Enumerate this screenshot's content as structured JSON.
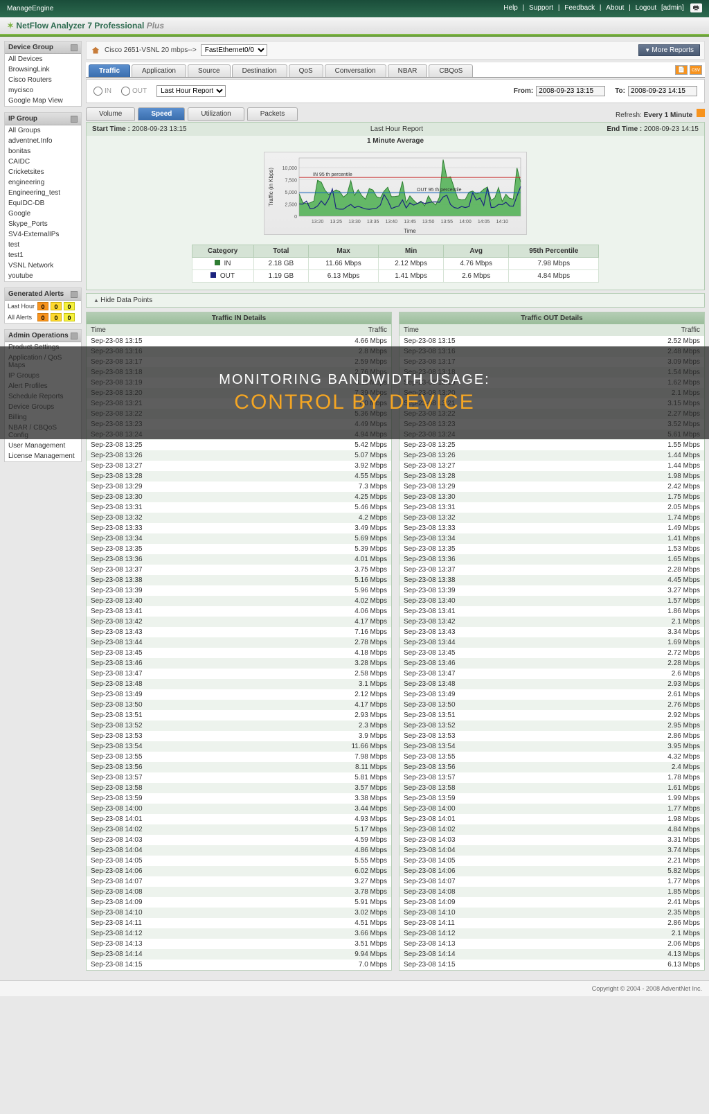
{
  "header": {
    "product": "ManageEngine",
    "title": "NetFlow Analyzer 7 Professional",
    "suffix": "Plus",
    "links": [
      "Help",
      "Support",
      "Feedback",
      "About",
      "Logout"
    ],
    "user": "[admin]"
  },
  "sidebar": {
    "device_group": {
      "title": "Device Group",
      "items": [
        "All Devices",
        "BrowsingLink",
        "Cisco Routers",
        "mycisco",
        "Google Map View"
      ]
    },
    "ip_group": {
      "title": "IP Group",
      "items": [
        "All Groups",
        "adventnet.Info",
        "bonitas",
        "CAIDC",
        "Cricketsites",
        "engineering",
        "Engineering_test",
        "EquIDC-DB",
        "Google",
        "Skype_Ports",
        "SV4-ExternalIPs",
        "test",
        "test1",
        "VSNL Network",
        "youtube"
      ]
    },
    "alerts": {
      "title": "Generated Alerts",
      "rows": [
        {
          "label": "Last Hour",
          "r": "0",
          "o": "0",
          "y": "0"
        },
        {
          "label": "All Alerts",
          "r": "0",
          "o": "0",
          "y": "0"
        }
      ]
    },
    "admin": {
      "title": "Admin Operations",
      "items": [
        "Product Settings",
        "Application / QoS Maps",
        "IP Groups",
        "Alert Profiles",
        "Schedule Reports",
        "Device Groups",
        "Billing",
        "NBAR / CBQoS Config",
        "User Management",
        "License Management"
      ]
    }
  },
  "breadcrumb": {
    "device": "Cisco 2651-VSNL 20 mbps-->",
    "iface": "FastEthernet0/0",
    "more": "More Reports"
  },
  "tabs": [
    "Traffic",
    "Application",
    "Source",
    "Destination",
    "QoS",
    "Conversation",
    "NBAR",
    "CBQoS"
  ],
  "filter": {
    "in": "IN",
    "out": "OUT",
    "report": "Last Hour Report",
    "from_l": "From:",
    "from": "2008-09-23 13:15",
    "to_l": "To:",
    "to": "2008-09-23 14:15"
  },
  "subtabs": [
    "Volume",
    "Speed",
    "Utilization",
    "Packets"
  ],
  "refresh": {
    "label": "Refresh:",
    "value": "Every 1 Minute"
  },
  "chart": {
    "start_l": "Start Time :",
    "start": "2008-09-23 13:15",
    "mid": "Last Hour Report",
    "end_l": "End Time :",
    "end": "2008-09-23 14:15",
    "title": "1 Minute Average",
    "ylabel": "Traffic (in Kbps)",
    "xlabel": "Time",
    "ann_in": "IN 95 th percentile",
    "ann_out": "OUT 95 th percentile"
  },
  "summary": {
    "headers": [
      "Category",
      "Total",
      "Max",
      "Min",
      "Avg",
      "95th Percentile"
    ],
    "rows": [
      {
        "cat": "IN",
        "total": "2.18 GB",
        "max": "11.66 Mbps",
        "min": "2.12 Mbps",
        "avg": "4.76 Mbps",
        "p95": "7.98 Mbps"
      },
      {
        "cat": "OUT",
        "total": "1.19 GB",
        "max": "6.13 Mbps",
        "min": "1.41 Mbps",
        "avg": "2.6 Mbps",
        "p95": "4.84 Mbps"
      }
    ]
  },
  "hide_dp": "Hide Data Points",
  "details": {
    "in_title": "Traffic IN Details",
    "out_title": "Traffic OUT Details",
    "col_time": "Time",
    "col_traffic": "Traffic",
    "in": [
      [
        "Sep-23-08 13:15",
        "4.66 Mbps"
      ],
      [
        "Sep-23-08 13:16",
        "2.8 Mbps"
      ],
      [
        "Sep-23-08 13:17",
        "2.59 Mbps"
      ],
      [
        "Sep-23-08 13:18",
        "2.76 Mbps"
      ],
      [
        "Sep-23-08 13:19",
        "3.11 Mbps"
      ],
      [
        "Sep-23-08 13:20",
        "7.39 Mbps"
      ],
      [
        "Sep-23-08 13:21",
        "7.0 Mbps"
      ],
      [
        "Sep-23-08 13:22",
        "5.36 Mbps"
      ],
      [
        "Sep-23-08 13:23",
        "4.49 Mbps"
      ],
      [
        "Sep-23-08 13:24",
        "4.94 Mbps"
      ],
      [
        "Sep-23-08 13:25",
        "5.42 Mbps"
      ],
      [
        "Sep-23-08 13:26",
        "5.07 Mbps"
      ],
      [
        "Sep-23-08 13:27",
        "3.92 Mbps"
      ],
      [
        "Sep-23-08 13:28",
        "4.55 Mbps"
      ],
      [
        "Sep-23-08 13:29",
        "7.3 Mbps"
      ],
      [
        "Sep-23-08 13:30",
        "4.25 Mbps"
      ],
      [
        "Sep-23-08 13:31",
        "5.46 Mbps"
      ],
      [
        "Sep-23-08 13:32",
        "4.2 Mbps"
      ],
      [
        "Sep-23-08 13:33",
        "3.49 Mbps"
      ],
      [
        "Sep-23-08 13:34",
        "5.69 Mbps"
      ],
      [
        "Sep-23-08 13:35",
        "5.39 Mbps"
      ],
      [
        "Sep-23-08 13:36",
        "4.01 Mbps"
      ],
      [
        "Sep-23-08 13:37",
        "3.75 Mbps"
      ],
      [
        "Sep-23-08 13:38",
        "5.16 Mbps"
      ],
      [
        "Sep-23-08 13:39",
        "5.96 Mbps"
      ],
      [
        "Sep-23-08 13:40",
        "4.02 Mbps"
      ],
      [
        "Sep-23-08 13:41",
        "4.06 Mbps"
      ],
      [
        "Sep-23-08 13:42",
        "4.17 Mbps"
      ],
      [
        "Sep-23-08 13:43",
        "7.16 Mbps"
      ],
      [
        "Sep-23-08 13:44",
        "2.78 Mbps"
      ],
      [
        "Sep-23-08 13:45",
        "4.18 Mbps"
      ],
      [
        "Sep-23-08 13:46",
        "3.28 Mbps"
      ],
      [
        "Sep-23-08 13:47",
        "2.58 Mbps"
      ],
      [
        "Sep-23-08 13:48",
        "3.1 Mbps"
      ],
      [
        "Sep-23-08 13:49",
        "2.12 Mbps"
      ],
      [
        "Sep-23-08 13:50",
        "4.17 Mbps"
      ],
      [
        "Sep-23-08 13:51",
        "2.93 Mbps"
      ],
      [
        "Sep-23-08 13:52",
        "2.3 Mbps"
      ],
      [
        "Sep-23-08 13:53",
        "3.9 Mbps"
      ],
      [
        "Sep-23-08 13:54",
        "11.66 Mbps"
      ],
      [
        "Sep-23-08 13:55",
        "7.98 Mbps"
      ],
      [
        "Sep-23-08 13:56",
        "8.11 Mbps"
      ],
      [
        "Sep-23-08 13:57",
        "5.81 Mbps"
      ],
      [
        "Sep-23-08 13:58",
        "3.57 Mbps"
      ],
      [
        "Sep-23-08 13:59",
        "3.38 Mbps"
      ],
      [
        "Sep-23-08 14:00",
        "3.44 Mbps"
      ],
      [
        "Sep-23-08 14:01",
        "4.93 Mbps"
      ],
      [
        "Sep-23-08 14:02",
        "5.17 Mbps"
      ],
      [
        "Sep-23-08 14:03",
        "4.59 Mbps"
      ],
      [
        "Sep-23-08 14:04",
        "4.86 Mbps"
      ],
      [
        "Sep-23-08 14:05",
        "5.55 Mbps"
      ],
      [
        "Sep-23-08 14:06",
        "6.02 Mbps"
      ],
      [
        "Sep-23-08 14:07",
        "3.27 Mbps"
      ],
      [
        "Sep-23-08 14:08",
        "3.78 Mbps"
      ],
      [
        "Sep-23-08 14:09",
        "5.91 Mbps"
      ],
      [
        "Sep-23-08 14:10",
        "3.02 Mbps"
      ],
      [
        "Sep-23-08 14:11",
        "4.51 Mbps"
      ],
      [
        "Sep-23-08 14:12",
        "3.66 Mbps"
      ],
      [
        "Sep-23-08 14:13",
        "3.51 Mbps"
      ],
      [
        "Sep-23-08 14:14",
        "9.94 Mbps"
      ],
      [
        "Sep-23-08 14:15",
        "7.0 Mbps"
      ]
    ],
    "out": [
      [
        "Sep-23-08 13:15",
        "2.52 Mbps"
      ],
      [
        "Sep-23-08 13:16",
        "2.48 Mbps"
      ],
      [
        "Sep-23-08 13:17",
        "3.09 Mbps"
      ],
      [
        "Sep-23-08 13:18",
        "1.54 Mbps"
      ],
      [
        "Sep-23-08 13:19",
        "1.62 Mbps"
      ],
      [
        "Sep-23-08 13:20",
        "2.1 Mbps"
      ],
      [
        "Sep-23-08 13:21",
        "3.15 Mbps"
      ],
      [
        "Sep-23-08 13:22",
        "2.27 Mbps"
      ],
      [
        "Sep-23-08 13:23",
        "3.52 Mbps"
      ],
      [
        "Sep-23-08 13:24",
        "5.61 Mbps"
      ],
      [
        "Sep-23-08 13:25",
        "1.55 Mbps"
      ],
      [
        "Sep-23-08 13:26",
        "1.44 Mbps"
      ],
      [
        "Sep-23-08 13:27",
        "1.44 Mbps"
      ],
      [
        "Sep-23-08 13:28",
        "1.98 Mbps"
      ],
      [
        "Sep-23-08 13:29",
        "2.42 Mbps"
      ],
      [
        "Sep-23-08 13:30",
        "1.75 Mbps"
      ],
      [
        "Sep-23-08 13:31",
        "2.05 Mbps"
      ],
      [
        "Sep-23-08 13:32",
        "1.74 Mbps"
      ],
      [
        "Sep-23-08 13:33",
        "1.49 Mbps"
      ],
      [
        "Sep-23-08 13:34",
        "1.41 Mbps"
      ],
      [
        "Sep-23-08 13:35",
        "1.53 Mbps"
      ],
      [
        "Sep-23-08 13:36",
        "1.65 Mbps"
      ],
      [
        "Sep-23-08 13:37",
        "2.28 Mbps"
      ],
      [
        "Sep-23-08 13:38",
        "4.45 Mbps"
      ],
      [
        "Sep-23-08 13:39",
        "3.27 Mbps"
      ],
      [
        "Sep-23-08 13:40",
        "1.57 Mbps"
      ],
      [
        "Sep-23-08 13:41",
        "1.86 Mbps"
      ],
      [
        "Sep-23-08 13:42",
        "2.1 Mbps"
      ],
      [
        "Sep-23-08 13:43",
        "3.34 Mbps"
      ],
      [
        "Sep-23-08 13:44",
        "1.69 Mbps"
      ],
      [
        "Sep-23-08 13:45",
        "2.72 Mbps"
      ],
      [
        "Sep-23-08 13:46",
        "2.28 Mbps"
      ],
      [
        "Sep-23-08 13:47",
        "2.6 Mbps"
      ],
      [
        "Sep-23-08 13:48",
        "2.93 Mbps"
      ],
      [
        "Sep-23-08 13:49",
        "2.61 Mbps"
      ],
      [
        "Sep-23-08 13:50",
        "2.76 Mbps"
      ],
      [
        "Sep-23-08 13:51",
        "2.92 Mbps"
      ],
      [
        "Sep-23-08 13:52",
        "2.95 Mbps"
      ],
      [
        "Sep-23-08 13:53",
        "2.86 Mbps"
      ],
      [
        "Sep-23-08 13:54",
        "3.95 Mbps"
      ],
      [
        "Sep-23-08 13:55",
        "4.32 Mbps"
      ],
      [
        "Sep-23-08 13:56",
        "2.4 Mbps"
      ],
      [
        "Sep-23-08 13:57",
        "1.78 Mbps"
      ],
      [
        "Sep-23-08 13:58",
        "1.61 Mbps"
      ],
      [
        "Sep-23-08 13:59",
        "1.99 Mbps"
      ],
      [
        "Sep-23-08 14:00",
        "1.77 Mbps"
      ],
      [
        "Sep-23-08 14:01",
        "1.98 Mbps"
      ],
      [
        "Sep-23-08 14:02",
        "4.84 Mbps"
      ],
      [
        "Sep-23-08 14:03",
        "3.31 Mbps"
      ],
      [
        "Sep-23-08 14:04",
        "3.74 Mbps"
      ],
      [
        "Sep-23-08 14:05",
        "2.21 Mbps"
      ],
      [
        "Sep-23-08 14:06",
        "5.82 Mbps"
      ],
      [
        "Sep-23-08 14:07",
        "1.77 Mbps"
      ],
      [
        "Sep-23-08 14:08",
        "1.85 Mbps"
      ],
      [
        "Sep-23-08 14:09",
        "2.41 Mbps"
      ],
      [
        "Sep-23-08 14:10",
        "2.35 Mbps"
      ],
      [
        "Sep-23-08 14:11",
        "2.86 Mbps"
      ],
      [
        "Sep-23-08 14:12",
        "2.1 Mbps"
      ],
      [
        "Sep-23-08 14:13",
        "2.06 Mbps"
      ],
      [
        "Sep-23-08 14:14",
        "4.13 Mbps"
      ],
      [
        "Sep-23-08 14:15",
        "6.13 Mbps"
      ]
    ]
  },
  "footer": "Copyright © 2004 - 2008 AdventNet Inc.",
  "overlay": {
    "l1": "MONITORING BANDWIDTH USAGE:",
    "l2": "CONTROL BY DEVICE"
  },
  "chart_data": {
    "type": "line",
    "title": "1 Minute Average",
    "xlabel": "Time",
    "ylabel": "Traffic (in Kbps)",
    "ylim": [
      0,
      12000
    ],
    "yticks": [
      0,
      2500,
      5000,
      7500,
      10000
    ],
    "xticks": [
      "13:20",
      "13:25",
      "13:30",
      "13:35",
      "13:40",
      "13:45",
      "13:50",
      "13:55",
      "14:00",
      "14:05",
      "14:10"
    ],
    "series": [
      {
        "name": "IN",
        "color": "#2e7d32",
        "fill": "#4caf50",
        "values": [
          4660,
          2800,
          2590,
          2760,
          3110,
          7390,
          7000,
          5360,
          4490,
          4940,
          5420,
          5070,
          3920,
          4550,
          7300,
          4250,
          5460,
          4200,
          3490,
          5690,
          5390,
          4010,
          3750,
          5160,
          5960,
          4020,
          4060,
          4170,
          7160,
          2780,
          4180,
          3280,
          2580,
          3100,
          2120,
          4170,
          2930,
          2300,
          3900,
          11660,
          7980,
          8110,
          5810,
          3570,
          3380,
          3440,
          4930,
          5170,
          4590,
          4860,
          5550,
          6020,
          3270,
          3780,
          5910,
          3020,
          4510,
          3660,
          3510,
          9940,
          7000
        ]
      },
      {
        "name": "OUT",
        "color": "#1a237e",
        "values": [
          2520,
          2480,
          3090,
          1540,
          1620,
          2100,
          3150,
          2270,
          3520,
          5610,
          1550,
          1440,
          1440,
          1980,
          2420,
          1750,
          2050,
          1740,
          1490,
          1410,
          1530,
          1650,
          2280,
          4450,
          3270,
          1570,
          1860,
          2100,
          3340,
          1690,
          2720,
          2280,
          2600,
          2930,
          2610,
          2760,
          2920,
          2950,
          2860,
          3950,
          4320,
          2400,
          1780,
          1610,
          1990,
          1770,
          1980,
          4840,
          3310,
          3740,
          2210,
          5820,
          1770,
          1850,
          2410,
          2350,
          2860,
          2100,
          2060,
          4130,
          6130
        ]
      }
    ],
    "percentiles": {
      "in_95": 7980,
      "out_95": 4840
    }
  }
}
